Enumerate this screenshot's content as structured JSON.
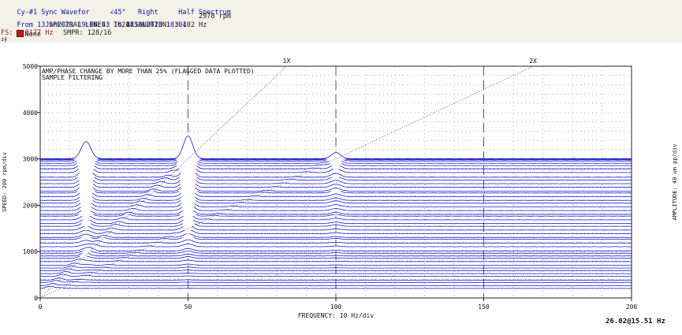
{
  "header": {
    "line1": {
      "channel": "Cy-#1 Sync Wavefor",
      "angle": "∠45°",
      "orientation": "Right",
      "spectrum_type": "Half Spectrum"
    },
    "line2": {
      "date_range": "From 13Jan2023 19:06:43 To 14JAN2023 18:04",
      "rpm": "2978 rpm"
    },
    "line3": {
      "status_icon": "alarm-icon",
      "status": "None",
      "spectral_lines": "SPECTRAL LINES: 1024",
      "resolution": "RESOLUTION: 3.102 Hz"
    },
    "line4": {
      "fs": "FS: 0-3177 Hz",
      "smpr": "SMPR: 128/16"
    },
    "line5": "z∮"
  },
  "chart_data": {
    "type": "line",
    "subtype": "waterfall",
    "annotations": [
      "AMP/PHASE CHANGE BY MORE THAN 25% (FLAGGED DATA PLOTTED)",
      "SAMPLE FILTERING"
    ],
    "xlabel": "FREQUENCY: 10 Hz/div",
    "ylabel": "SPEED: 200 rpm/div",
    "y2label": "AMPLITUDE: 40 um pp/div",
    "xlim": [
      0,
      200
    ],
    "ylim": [
      0,
      5000
    ],
    "x_ticks": [
      0,
      50,
      100,
      150,
      200
    ],
    "y_ticks": [
      0,
      1000,
      2000,
      3000,
      4000,
      5000
    ],
    "order_lines": [
      {
        "label": "1X",
        "order": 1
      },
      {
        "label": "2X",
        "order": 2
      }
    ],
    "order_markers": [
      50,
      100,
      150
    ],
    "trace_speeds": [
      200,
      260,
      330,
      380,
      460,
      520,
      580,
      640,
      700,
      780,
      850,
      900,
      960,
      1010,
      1100,
      1180,
      1260,
      1300,
      1380,
      1460,
      1540,
      1600,
      1680,
      1760,
      1800,
      1880,
      1960,
      2040,
      2100,
      2180,
      2260,
      2300,
      2380,
      2460,
      2540,
      2600,
      2700,
      2780,
      2850,
      2900,
      2950,
      2975,
      2990,
      3000
    ],
    "peaks": [
      {
        "freq": 15.5,
        "amp_um_pp": 40
      },
      {
        "freq": 50,
        "amp_um_pp": 80
      },
      {
        "freq": 100,
        "amp_um_pp": 20
      }
    ],
    "grid": true,
    "colors": {
      "traces": "#1a1acc",
      "grid": "#666666",
      "order_lines": "#444444"
    }
  },
  "footer": {
    "stamp": "26.02@15.51 Hz"
  }
}
